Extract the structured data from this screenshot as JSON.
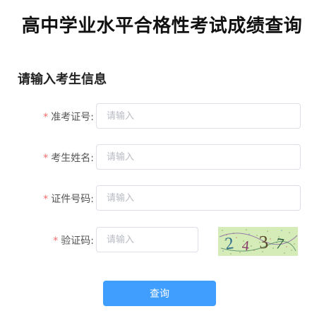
{
  "page": {
    "title": "高中学业水平合格性考试成绩查询"
  },
  "form": {
    "section_title": "请输入考生信息",
    "required_mark": "*",
    "fields": [
      {
        "label": "准考证号:",
        "placeholder": "请输入",
        "value": ""
      },
      {
        "label": "考生姓名:",
        "placeholder": "请输入",
        "value": ""
      },
      {
        "label": "证件号码:",
        "placeholder": "请输入",
        "value": ""
      },
      {
        "label": "验证码:",
        "placeholder": "请输入",
        "value": ""
      }
    ],
    "captcha": {
      "text": "2437",
      "background_color": "#d6ecb8"
    },
    "submit_label": "查询"
  },
  "colors": {
    "primary": "#409eff",
    "required": "#f56c6c"
  }
}
